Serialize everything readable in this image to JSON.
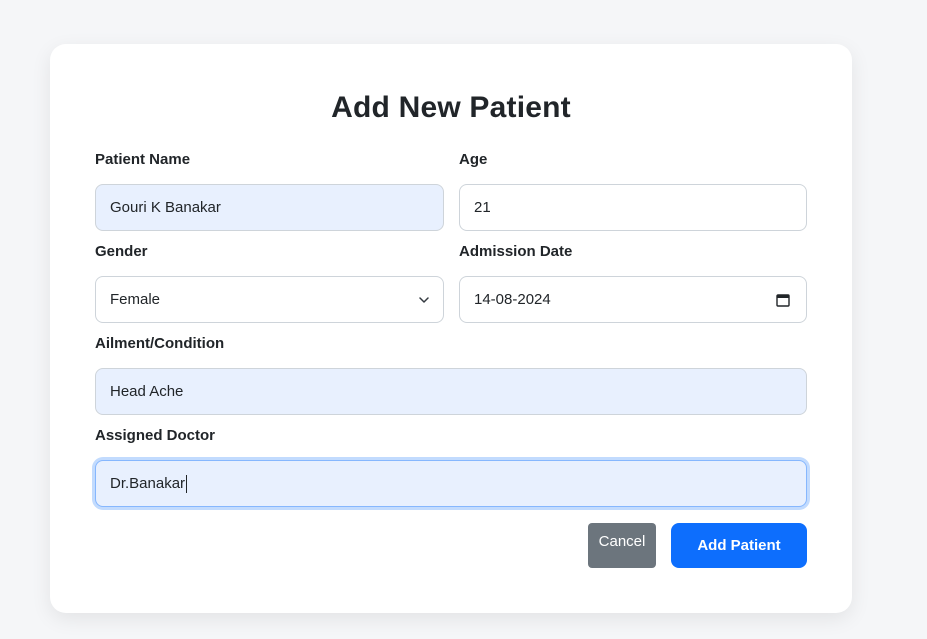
{
  "form": {
    "title": "Add New Patient",
    "fields": {
      "patient_name": {
        "label": "Patient Name",
        "value": "Gouri K Banakar"
      },
      "age": {
        "label": "Age",
        "value": "21"
      },
      "gender": {
        "label": "Gender",
        "value": "Female",
        "icon": "chevron-down-icon"
      },
      "admission_date": {
        "label": "Admission Date",
        "value": "14-08-2024",
        "icon": "calendar-icon"
      },
      "ailment": {
        "label": "Ailment/Condition",
        "value": "Head Ache"
      },
      "doctor": {
        "label": "Assigned Doctor",
        "value": "Dr.Banakar"
      }
    },
    "buttons": {
      "cancel": "Cancel",
      "submit": "Add Patient"
    }
  },
  "colors": {
    "primary": "#0d6efd",
    "secondary": "#6c757d",
    "autofill_bg": "#e8f0fe",
    "page_bg": "#f5f6f8",
    "card_bg": "#ffffff"
  }
}
